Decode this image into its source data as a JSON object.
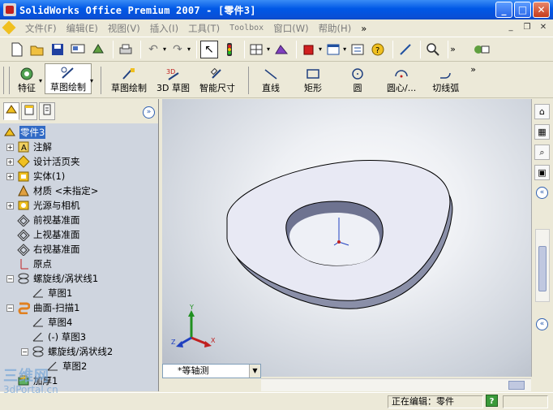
{
  "window": {
    "title": "SolidWorks Office Premium 2007 - [零件3]",
    "buttons": {
      "minimize": "_",
      "maximize": "□",
      "close": "✕"
    }
  },
  "menu": {
    "items": [
      "文件(F)",
      "编辑(E)",
      "视图(V)",
      "插入(I)",
      "工具(T)",
      "Toolbox",
      "窗口(W)",
      "帮助(H)"
    ],
    "overflow": "»"
  },
  "command_manager": {
    "items": [
      {
        "label": "特征",
        "icon": "feature-icon"
      },
      {
        "label": "草图绘制",
        "icon": "sketch-icon",
        "pressed": true
      },
      {
        "label": "草图绘制",
        "icon": "sketch-draw-icon"
      },
      {
        "label": "3D 草图",
        "icon": "3d-sketch-icon"
      },
      {
        "label": "智能尺寸",
        "icon": "smart-dimension-icon"
      },
      {
        "label": "直线",
        "icon": "line-icon"
      },
      {
        "label": "矩形",
        "icon": "rectangle-icon"
      },
      {
        "label": "圆",
        "icon": "circle-icon"
      },
      {
        "label": "圆心/...",
        "icon": "centerpoint-arc-icon"
      },
      {
        "label": "切线弧",
        "icon": "tangent-arc-icon"
      }
    ]
  },
  "feature_tree": {
    "root": "零件3",
    "items": [
      {
        "label": "注解",
        "icon": "annotations-icon",
        "expandable": true,
        "indent": 0
      },
      {
        "label": "设计活页夹",
        "icon": "design-binder-icon",
        "expandable": true,
        "indent": 0
      },
      {
        "label": "实体(1)",
        "icon": "solid-bodies-icon",
        "expandable": true,
        "indent": 0
      },
      {
        "label": "材质 <未指定>",
        "icon": "material-icon",
        "expandable": false,
        "indent": 0
      },
      {
        "label": "光源与相机",
        "icon": "lights-cameras-icon",
        "expandable": true,
        "indent": 0
      },
      {
        "label": "前视基准面",
        "icon": "plane-icon",
        "expandable": false,
        "indent": 0
      },
      {
        "label": "上视基准面",
        "icon": "plane-icon",
        "expandable": false,
        "indent": 0
      },
      {
        "label": "右视基准面",
        "icon": "plane-icon",
        "expandable": false,
        "indent": 0
      },
      {
        "label": "原点",
        "icon": "origin-icon",
        "expandable": false,
        "indent": 0
      },
      {
        "label": "螺旋线/涡状线1",
        "icon": "helix-icon",
        "expandable": true,
        "expanded": true,
        "indent": 0
      },
      {
        "label": "草图1",
        "icon": "sketch-icon",
        "expandable": false,
        "indent": 1
      },
      {
        "label": "曲面-扫描1",
        "icon": "surface-sweep-icon",
        "expandable": true,
        "expanded": true,
        "indent": 0
      },
      {
        "label": "草图4",
        "icon": "sketch-icon",
        "expandable": false,
        "indent": 1
      },
      {
        "label": "(-) 草图3",
        "icon": "sketch-icon",
        "expandable": false,
        "indent": 1
      },
      {
        "label": "螺旋线/涡状线2",
        "icon": "helix-icon",
        "expandable": true,
        "expanded": true,
        "indent": 1
      },
      {
        "label": "草图2",
        "icon": "sketch-icon",
        "expandable": false,
        "indent": 2
      },
      {
        "label": "加厚1",
        "icon": "thicken-icon",
        "expandable": false,
        "indent": 0
      }
    ]
  },
  "viewport": {
    "view_orientation": "*等轴测",
    "triad": {
      "x": "X",
      "y": "Y",
      "z": "Z"
    }
  },
  "statusbar": {
    "status": "正在编辑：零件",
    "help": "?"
  },
  "watermark": {
    "top": "三维网",
    "bottom": "3dPortal.cn"
  },
  "colors": {
    "titlebar": "#0058e6",
    "selection": "#316ac5",
    "tree_bg": "#cfd5df",
    "part_face": "#e6e6f4"
  }
}
